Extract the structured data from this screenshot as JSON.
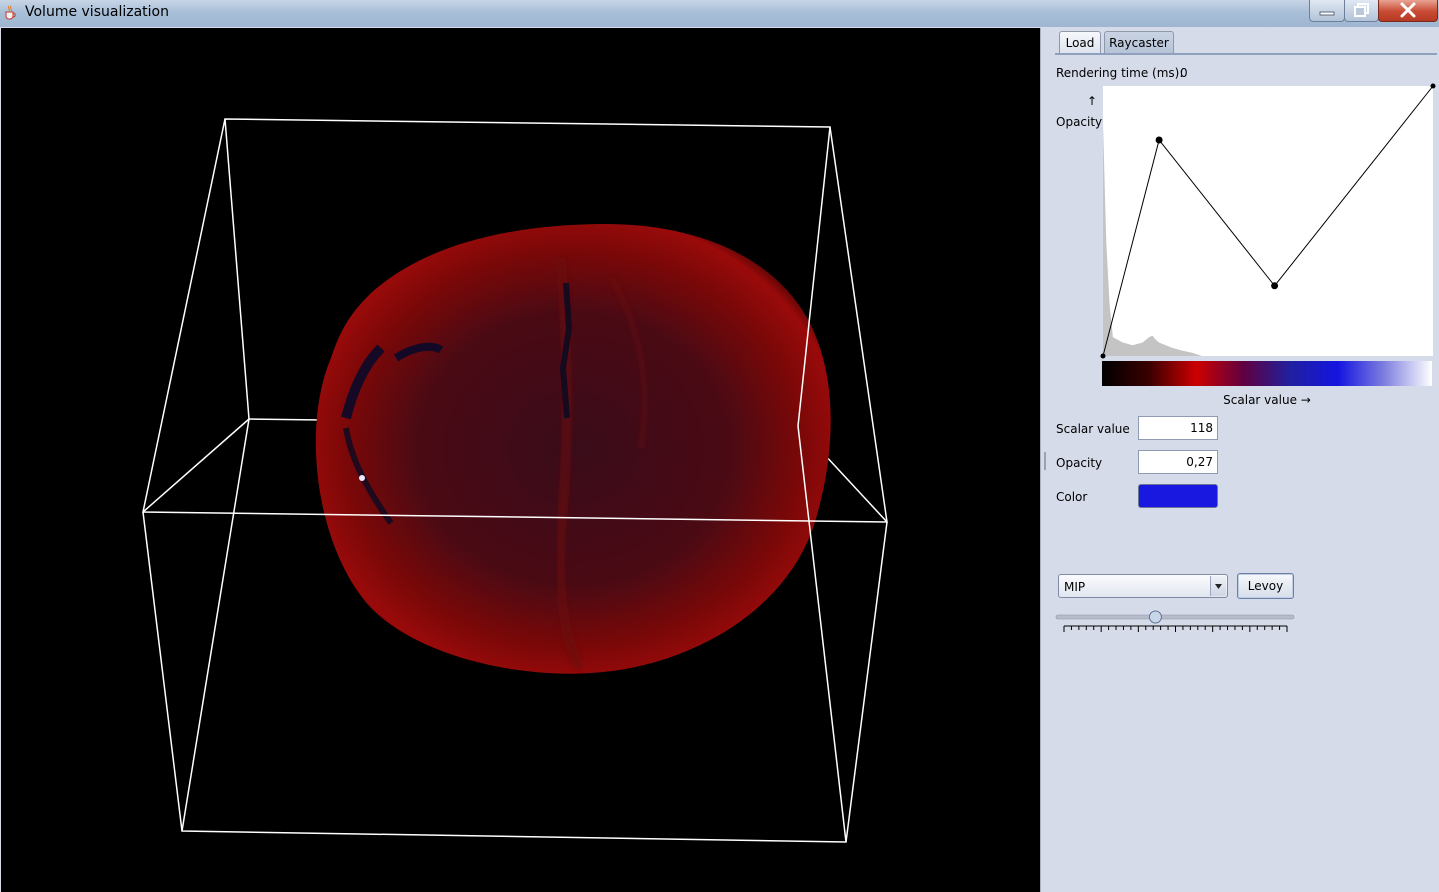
{
  "window": {
    "title": "Volume visualization",
    "app_icon": "java-cup-icon",
    "controls": [
      "minimize-icon",
      "maximize-icon",
      "close-icon"
    ]
  },
  "tabs": [
    {
      "label": "Load",
      "selected": false
    },
    {
      "label": "Raycaster",
      "selected": true
    }
  ],
  "rendering_time": {
    "label": "Rendering time (ms):",
    "value": "0"
  },
  "transfer_function": {
    "y_label": "Opacity",
    "y_arrow": "↑",
    "x_label": "Scalar value →",
    "colorbar_stops": [
      "#000000",
      "#3a0000",
      "#cc0000",
      "#600040",
      "#2020a0",
      "#1414e0",
      "#8080e0",
      "#ffffff"
    ]
  },
  "chart_data": {
    "type": "line",
    "title": "",
    "xlabel": "Scalar value →",
    "ylabel": "Opacity",
    "xlim": [
      0,
      1
    ],
    "ylim": [
      0,
      1
    ],
    "series": [
      {
        "x": [
          0.0,
          0.17,
          0.52,
          1.0
        ],
        "y": [
          0.0,
          0.8,
          0.26,
          1.0
        ]
      }
    ],
    "histogram": {
      "x": [
        0.0,
        0.01,
        0.02,
        0.03,
        0.06,
        0.09,
        0.12,
        0.14,
        0.15,
        0.16,
        0.17,
        0.19,
        0.21,
        0.24,
        0.27,
        0.3
      ],
      "y": [
        0.86,
        0.42,
        0.19,
        0.07,
        0.05,
        0.04,
        0.05,
        0.07,
        0.075,
        0.06,
        0.05,
        0.04,
        0.03,
        0.02,
        0.012,
        0.0
      ]
    },
    "grid": false
  },
  "fields": {
    "scalar_label": "Scalar value",
    "scalar_value": "118",
    "opacity_label": "Opacity",
    "opacity_value": "0,27",
    "color_label": "Color",
    "color_value": "#1818e0"
  },
  "mode": {
    "selected": "MIP",
    "button_label": "Levoy"
  },
  "slider": {
    "value_fraction": 0.41,
    "tick_count": 31
  }
}
